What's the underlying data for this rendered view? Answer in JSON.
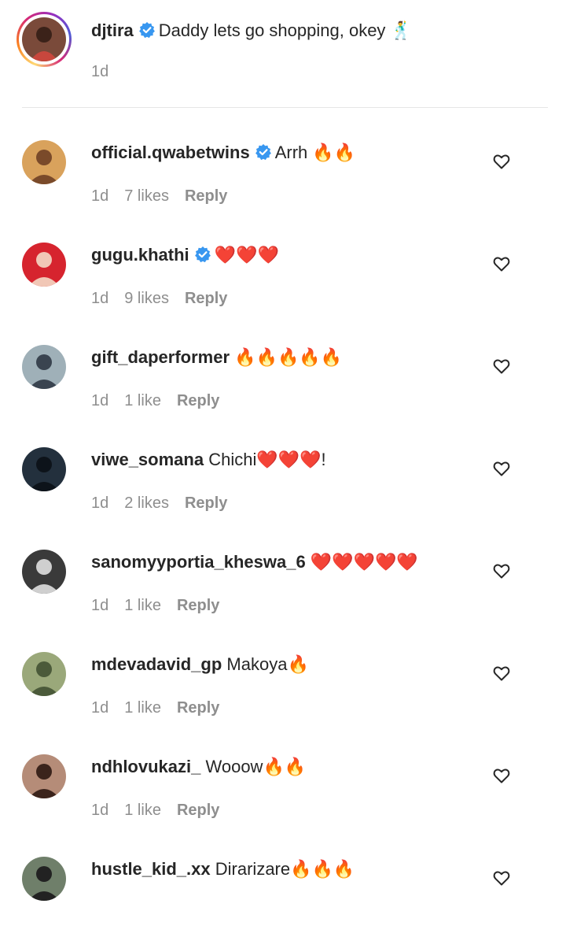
{
  "caption": {
    "username": "djtira",
    "verified": true,
    "text": "Daddy lets go shopping, okey",
    "emoji": "🕺",
    "time": "1d"
  },
  "comments": [
    {
      "username": "official.qwabetwins",
      "verified": true,
      "text": "Arrh ",
      "emoji": "🔥🔥",
      "emoji_kind": "fire",
      "time": "1d",
      "likes": "7 likes",
      "reply": "Reply"
    },
    {
      "username": "gugu.khathi",
      "verified": true,
      "text": "",
      "emoji": "❤️❤️❤️",
      "emoji_kind": "heart",
      "time": "1d",
      "likes": "9 likes",
      "reply": "Reply"
    },
    {
      "username": "gift_daperformer",
      "verified": false,
      "text": "",
      "emoji": "🔥🔥🔥🔥🔥",
      "emoji_kind": "fire",
      "time": "1d",
      "likes": "1 like",
      "reply": "Reply"
    },
    {
      "username": "viwe_somana",
      "verified": false,
      "text": "Chichi",
      "emoji": "❤️❤️❤️",
      "emoji_kind": "heart",
      "text_after": "!",
      "time": "1d",
      "likes": "2 likes",
      "reply": "Reply"
    },
    {
      "username": "sanomyyportia_kheswa_6",
      "verified": false,
      "text": "",
      "emoji": "❤️❤️❤️❤️❤️",
      "emoji_kind": "heart",
      "time": "1d",
      "likes": "1 like",
      "reply": "Reply"
    },
    {
      "username": "mdevadavid_gp",
      "verified": false,
      "text": "Makoya",
      "emoji": "🔥",
      "emoji_kind": "fire",
      "time": "1d",
      "likes": "1 like",
      "reply": "Reply"
    },
    {
      "username": "ndhlovukazi_",
      "verified": false,
      "text": "Wooow",
      "emoji": "🔥🔥",
      "emoji_kind": "fire",
      "time": "1d",
      "likes": "1 like",
      "reply": "Reply"
    },
    {
      "username": "hustle_kid_.xx",
      "verified": false,
      "text": "Dirarizare",
      "emoji": "🔥🔥🔥",
      "emoji_kind": "fire",
      "time": "",
      "likes": "",
      "reply": ""
    }
  ],
  "colors": {
    "text": "#262626",
    "meta": "#8e8e8e",
    "verified": "#3897f0",
    "divider": "#e6e6e6"
  },
  "icons": {
    "verified": "verified-badge-icon",
    "like": "heart-outline-icon"
  }
}
